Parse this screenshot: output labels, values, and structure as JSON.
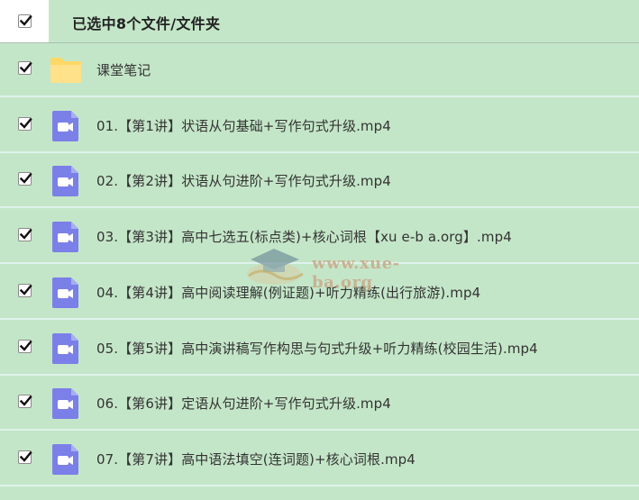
{
  "header": {
    "title": "已选中8个文件/文件夹",
    "checked": true
  },
  "rows": [
    {
      "label": "课堂笔记",
      "type": "folder",
      "checked": true
    },
    {
      "label": "01.【第1讲】状语从句基础+写作句式升级.mp4",
      "type": "video",
      "checked": true
    },
    {
      "label": "02.【第2讲】状语从句进阶+写作句式升级.mp4",
      "type": "video",
      "checked": true
    },
    {
      "label": "03.【第3讲】高中七选五(标点类)+核心词根【xu e-b a.org】.mp4",
      "type": "video",
      "checked": true
    },
    {
      "label": "04.【第4讲】高中阅读理解(例证题)+听力精练(出行旅游).mp4",
      "type": "video",
      "checked": true
    },
    {
      "label": "05.【第5讲】高中演讲稿写作构思与句式升级+听力精练(校园生活).mp4",
      "type": "video",
      "checked": true
    },
    {
      "label": "06.【第6讲】定语从句进阶+写作句式升级.mp4",
      "type": "video",
      "checked": true
    },
    {
      "label": "07.【第7讲】高中语法填空(连词题)+核心词根.mp4",
      "type": "video",
      "checked": true
    }
  ],
  "watermark": {
    "text": "www.xue-ba.org"
  },
  "colors": {
    "background": "#c4e6c8",
    "folder": "#ffd766",
    "video_icon": "#7b7fe8",
    "row_divider": "#dff2ec"
  }
}
